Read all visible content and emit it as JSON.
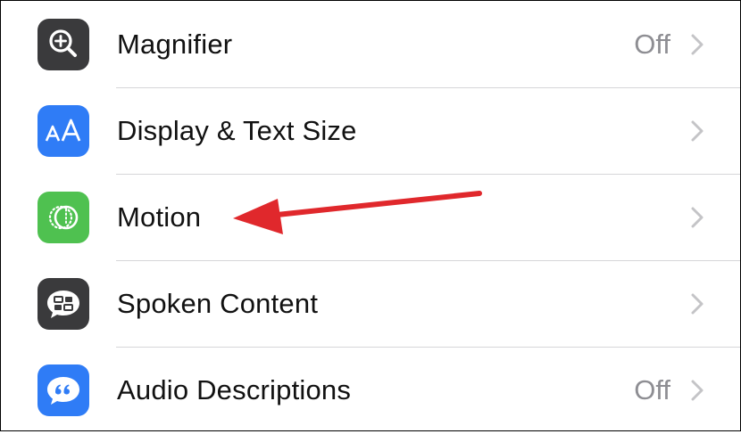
{
  "settings": {
    "items": [
      {
        "label": "Magnifier",
        "value": "Off",
        "icon": "magnifier-icon",
        "color": "#3a3a3c"
      },
      {
        "label": "Display & Text Size",
        "value": "",
        "icon": "text-size-icon",
        "color": "#2f7cf6"
      },
      {
        "label": "Motion",
        "value": "",
        "icon": "motion-icon",
        "color": "#4fc150"
      },
      {
        "label": "Spoken Content",
        "value": "",
        "icon": "spoken-content-icon",
        "color": "#3a3a3c"
      },
      {
        "label": "Audio Descriptions",
        "value": "Off",
        "icon": "audio-descriptions-icon",
        "color": "#2f7cf6"
      }
    ]
  },
  "annotation": {
    "arrow_color": "#e0282c",
    "points_to": "Motion"
  }
}
